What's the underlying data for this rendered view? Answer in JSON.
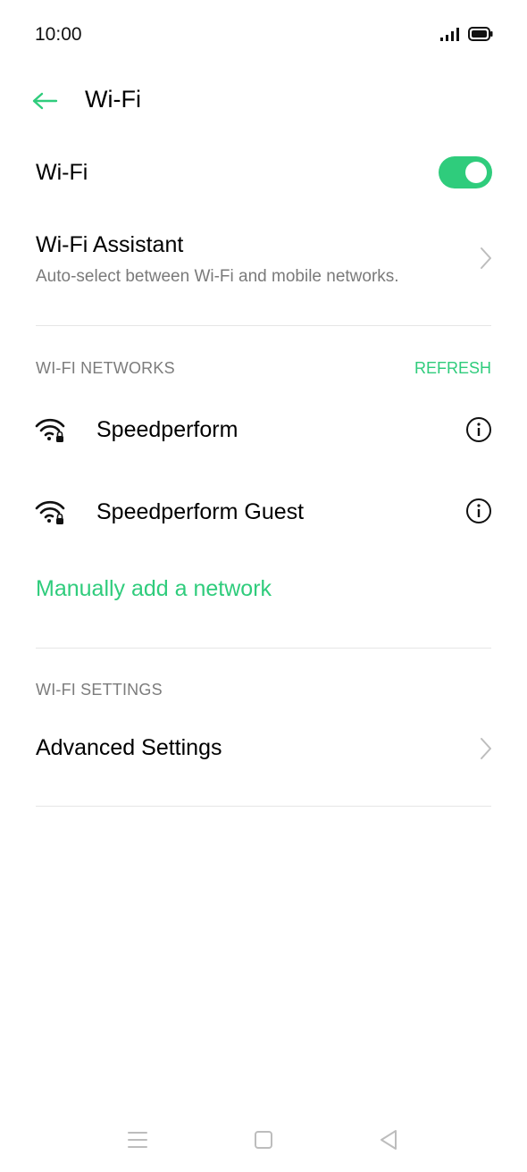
{
  "status_bar": {
    "time": "10:00",
    "icons": [
      "signal-icon",
      "battery-icon"
    ]
  },
  "header": {
    "title": "Wi-Fi",
    "back_icon": "arrow-left-icon"
  },
  "wifi_toggle_row": {
    "label": "Wi-Fi",
    "enabled": true
  },
  "assistant_row": {
    "title": "Wi-Fi Assistant",
    "subtitle": "Auto-select between Wi-Fi and mobile networks."
  },
  "networks_section": {
    "label": "WI-FI NETWORKS",
    "refresh_label": "REFRESH",
    "networks": [
      {
        "name": "Speedperform",
        "secured": true
      },
      {
        "name": "Speedperform Guest",
        "secured": true
      }
    ],
    "add_network_label": "Manually add a network"
  },
  "settings_section": {
    "label": "WI-FI SETTINGS",
    "advanced_label": "Advanced Settings"
  },
  "colors": {
    "accent": "#2fcc7c",
    "text_primary": "#000000",
    "text_secondary": "#7a7a7a",
    "divider": "#e6e6e6"
  },
  "nav_bar": {
    "icons": [
      "menu-icon",
      "home-square-icon",
      "back-triangle-icon"
    ]
  }
}
